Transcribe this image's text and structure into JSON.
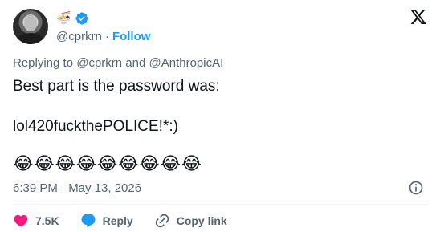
{
  "author": {
    "name_emoji": "🍜",
    "handle": "@cprkrn",
    "separator": "·",
    "follow_label": "Follow"
  },
  "reply_context": {
    "prefix": "Replying to",
    "mention_1": "@cprkrn",
    "conjunction": "and",
    "mention_2": "@AnthropicAI"
  },
  "tweet": {
    "line_1": "Best part is the password was:",
    "line_2": "lol420fuckthePOLICE!*:)",
    "emojis": "😂😂😂😂😂😂😂😂😂"
  },
  "timestamp": "6:39 PM · May 13, 2026",
  "actions": {
    "likes_count": "7.5K",
    "reply_label": "Reply",
    "copy_link_label": "Copy link"
  },
  "icons": {
    "verified": "verified-badge-icon",
    "logo": "x-logo-icon",
    "info": "info-icon",
    "like": "heart-icon",
    "reply": "reply-bubble-icon",
    "link": "link-icon"
  },
  "colors": {
    "accent": "#1d9bf0",
    "like": "#f91880",
    "secondary_text": "#536471",
    "primary_text": "#0f1419"
  }
}
